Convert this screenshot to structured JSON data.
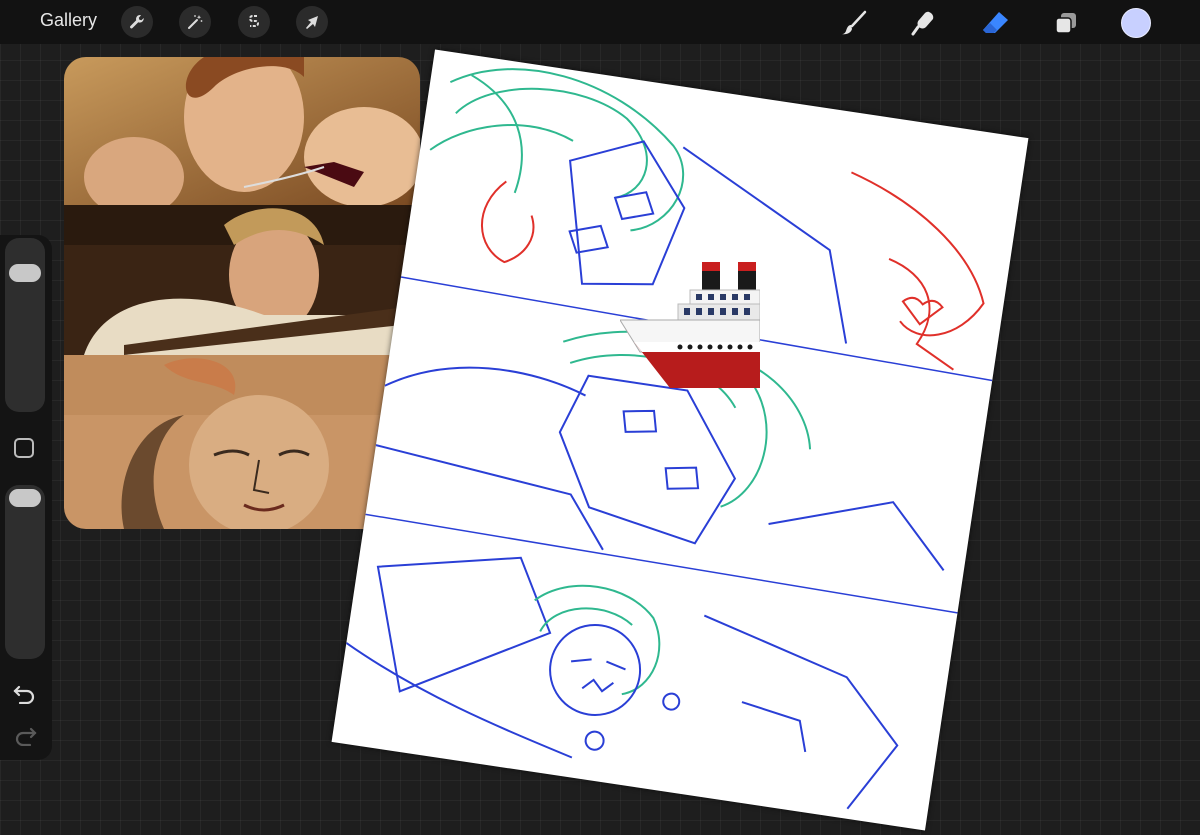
{
  "topbar": {
    "gallery_label": "Gallery",
    "action_icons": [
      "wrench-icon",
      "magic-wand-icon",
      "selection-icon",
      "transform-arrow-icon"
    ],
    "tool_icons": [
      "brush-icon",
      "smudge-icon",
      "eraser-icon",
      "layers-icon"
    ],
    "active_tool": "eraser-icon",
    "current_color": "#c8d0ff"
  },
  "sidebar": {
    "sliders": [
      "brush-size-slider",
      "opacity-slider"
    ],
    "buttons": [
      "modify-button",
      "undo-icon",
      "redo-icon"
    ]
  },
  "reference": {
    "panels": 3
  },
  "colors": {
    "sketch_blue": "#2a3fd6",
    "sketch_teal": "#2fb88f",
    "sketch_red": "#e0302a",
    "active_tool": "#3a86ff"
  }
}
